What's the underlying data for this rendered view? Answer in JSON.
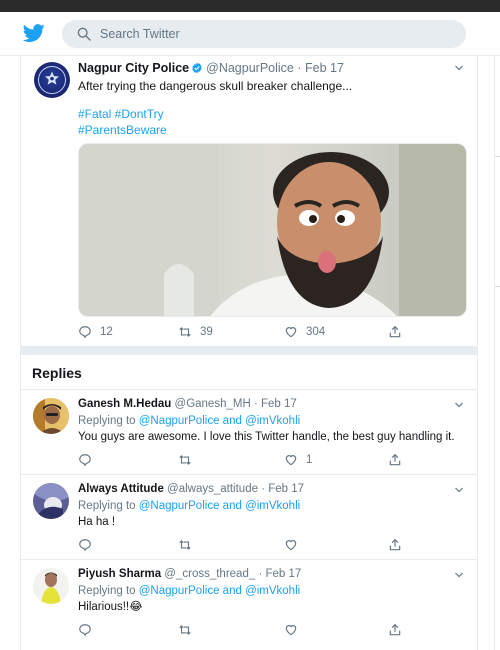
{
  "header": {
    "logo_icon": "twitter-bird-icon",
    "search_placeholder": "Search Twitter",
    "brand_color": "#1da1f2"
  },
  "main_tweet": {
    "name": "Nagpur City Police",
    "verified": true,
    "handle": "@NagpurPolice",
    "separator": "·",
    "date": "Feb 17",
    "text": "After trying the dangerous skull breaker challenge...",
    "hashtags": [
      "#Fatal #DontTry",
      "#ParentsBeware"
    ],
    "actions": {
      "replies": "12",
      "retweets": "39",
      "likes": "304"
    }
  },
  "replies_section": {
    "title": "Replies",
    "replying_prefix": "Replying to",
    "and": "and",
    "items": [
      {
        "name": "Ganesh M.Hedau",
        "handle": "@Ganesh_MH",
        "date": "Feb 17",
        "mention1": "@NagpurPolice",
        "mention2": "@imVkohli",
        "text": "You guys are awesome. I love this Twitter handle, the best guy handling it.",
        "likes": "1"
      },
      {
        "name": "Always Attitude",
        "handle": "@always_attitude",
        "date": "Feb 17",
        "mention1": "@NagpurPolice",
        "mention2": "@imVkohli",
        "text": "Ha ha !",
        "likes": ""
      },
      {
        "name": "Piyush Sharma",
        "handle": "@_cross_thread_",
        "date": "Feb 17",
        "mention1": "@NagpurPolice",
        "mention2": "@imVkohli",
        "text": "Hilarious!!😂",
        "likes": ""
      }
    ]
  },
  "colors": {
    "link": "#1da1f2",
    "muted": "#657786",
    "divider": "#e6ecf0"
  }
}
